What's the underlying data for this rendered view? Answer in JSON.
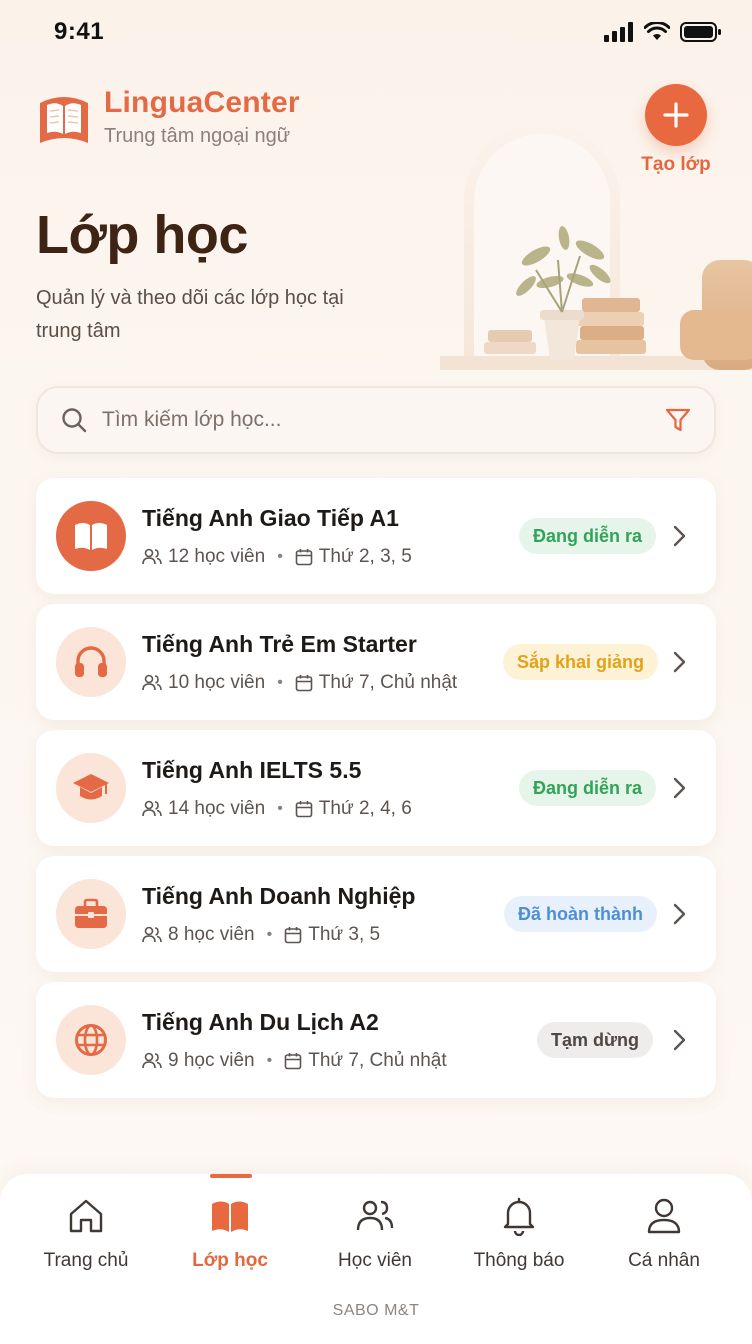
{
  "status_bar": {
    "time": "9:41"
  },
  "brand": {
    "name": "LinguaCenter",
    "subtitle": "Trung tâm ngoại ngữ"
  },
  "header": {
    "create_label": "Tạo lớp",
    "title": "Lớp học",
    "subtitle": "Quản lý và theo dõi các lớp học tại trung tâm"
  },
  "search": {
    "placeholder": "Tìm kiếm lớp học...",
    "value": ""
  },
  "classes": [
    {
      "name": "Tiếng Anh Giao Tiếp A1",
      "students": "12 học viên",
      "schedule": "Thứ 2, 3, 5",
      "status": "Đang diễn ra",
      "icon": "book-icon"
    },
    {
      "name": "Tiếng Anh Trẻ Em Starter",
      "students": "10 học viên",
      "schedule": "Thứ 7, Chủ nhật",
      "status": "Sắp khai giảng",
      "icon": "headphones-icon"
    },
    {
      "name": "Tiếng Anh IELTS 5.5",
      "students": "14 học viên",
      "schedule": "Thứ 2, 4, 6",
      "status": "Đang diễn ra",
      "icon": "graduation-cap-icon"
    },
    {
      "name": "Tiếng Anh Doanh Nghiệp",
      "students": "8 học viên",
      "schedule": "Thứ 3, 5",
      "status": "Đã hoàn thành",
      "icon": "briefcase-icon"
    },
    {
      "name": "Tiếng Anh Du Lịch A2",
      "students": "9 học viên",
      "schedule": "Thứ 7, Chủ nhật",
      "status": "Tạm dừng",
      "icon": "globe-icon"
    }
  ],
  "nav": [
    {
      "label": "Trang chủ",
      "icon": "home-icon"
    },
    {
      "label": "Lớp học",
      "icon": "book-icon",
      "active": true
    },
    {
      "label": "Học viên",
      "icon": "users-icon"
    },
    {
      "label": "Thông báo",
      "icon": "bell-icon"
    },
    {
      "label": "Cá nhân",
      "icon": "user-icon"
    }
  ],
  "footer": {
    "brand": "SABO M&T"
  },
  "colors": {
    "accent": "#e8693f",
    "title": "#3e2415",
    "ongoing": "#34a35a",
    "upcoming": "#e2a316",
    "done": "#4f8fd6",
    "paused": "#4e4744"
  }
}
